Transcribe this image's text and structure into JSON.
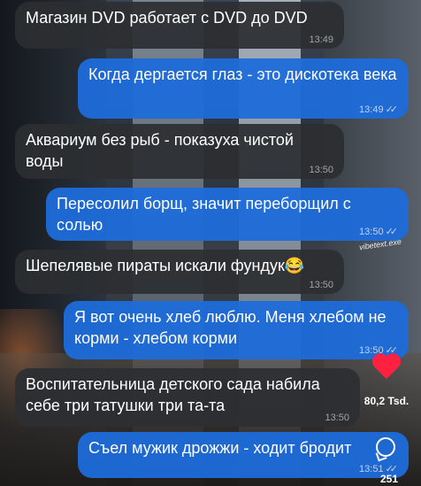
{
  "messages": [
    {
      "direction": "in",
      "text": "Магазин DVD работает с DVD до DVD",
      "time": "13:49"
    },
    {
      "direction": "out",
      "text": "Когда дергается глаз - это дискотека века",
      "time": "13:49",
      "read": true
    },
    {
      "direction": "in",
      "text": "Аквариум без рыб - показуха чистой воды",
      "time": "13:50"
    },
    {
      "direction": "out",
      "text": "Пересолил борщ, значит переборщил с солью",
      "time": "13:50",
      "read": true
    },
    {
      "direction": "in",
      "text": "Шепелявые пираты искали фундук😂",
      "time": "13:50"
    },
    {
      "direction": "out",
      "text": "Я вот очень хлеб люблю. Меня хлебом не корми - хлебом корми",
      "time": "13:50",
      "read": true
    },
    {
      "direction": "in",
      "text": "Воспитательница детского сада набила себе три татушки три та-та",
      "time": "13:50"
    },
    {
      "direction": "out",
      "text": "Съел мужик дрожжи - ходит бродит",
      "time": "13:51",
      "read": true
    }
  ],
  "read_receipt": "✓✓",
  "watermark": "vibetext.exe",
  "reactions": {
    "like_icon": "heart-icon",
    "like_count": "80,2 Tsd.",
    "comment_icon": "comment-icon",
    "comment_count": "251"
  },
  "colors": {
    "incoming": "#2c2e32",
    "outgoing": "#1e6cda",
    "heart": "#ff2240"
  }
}
